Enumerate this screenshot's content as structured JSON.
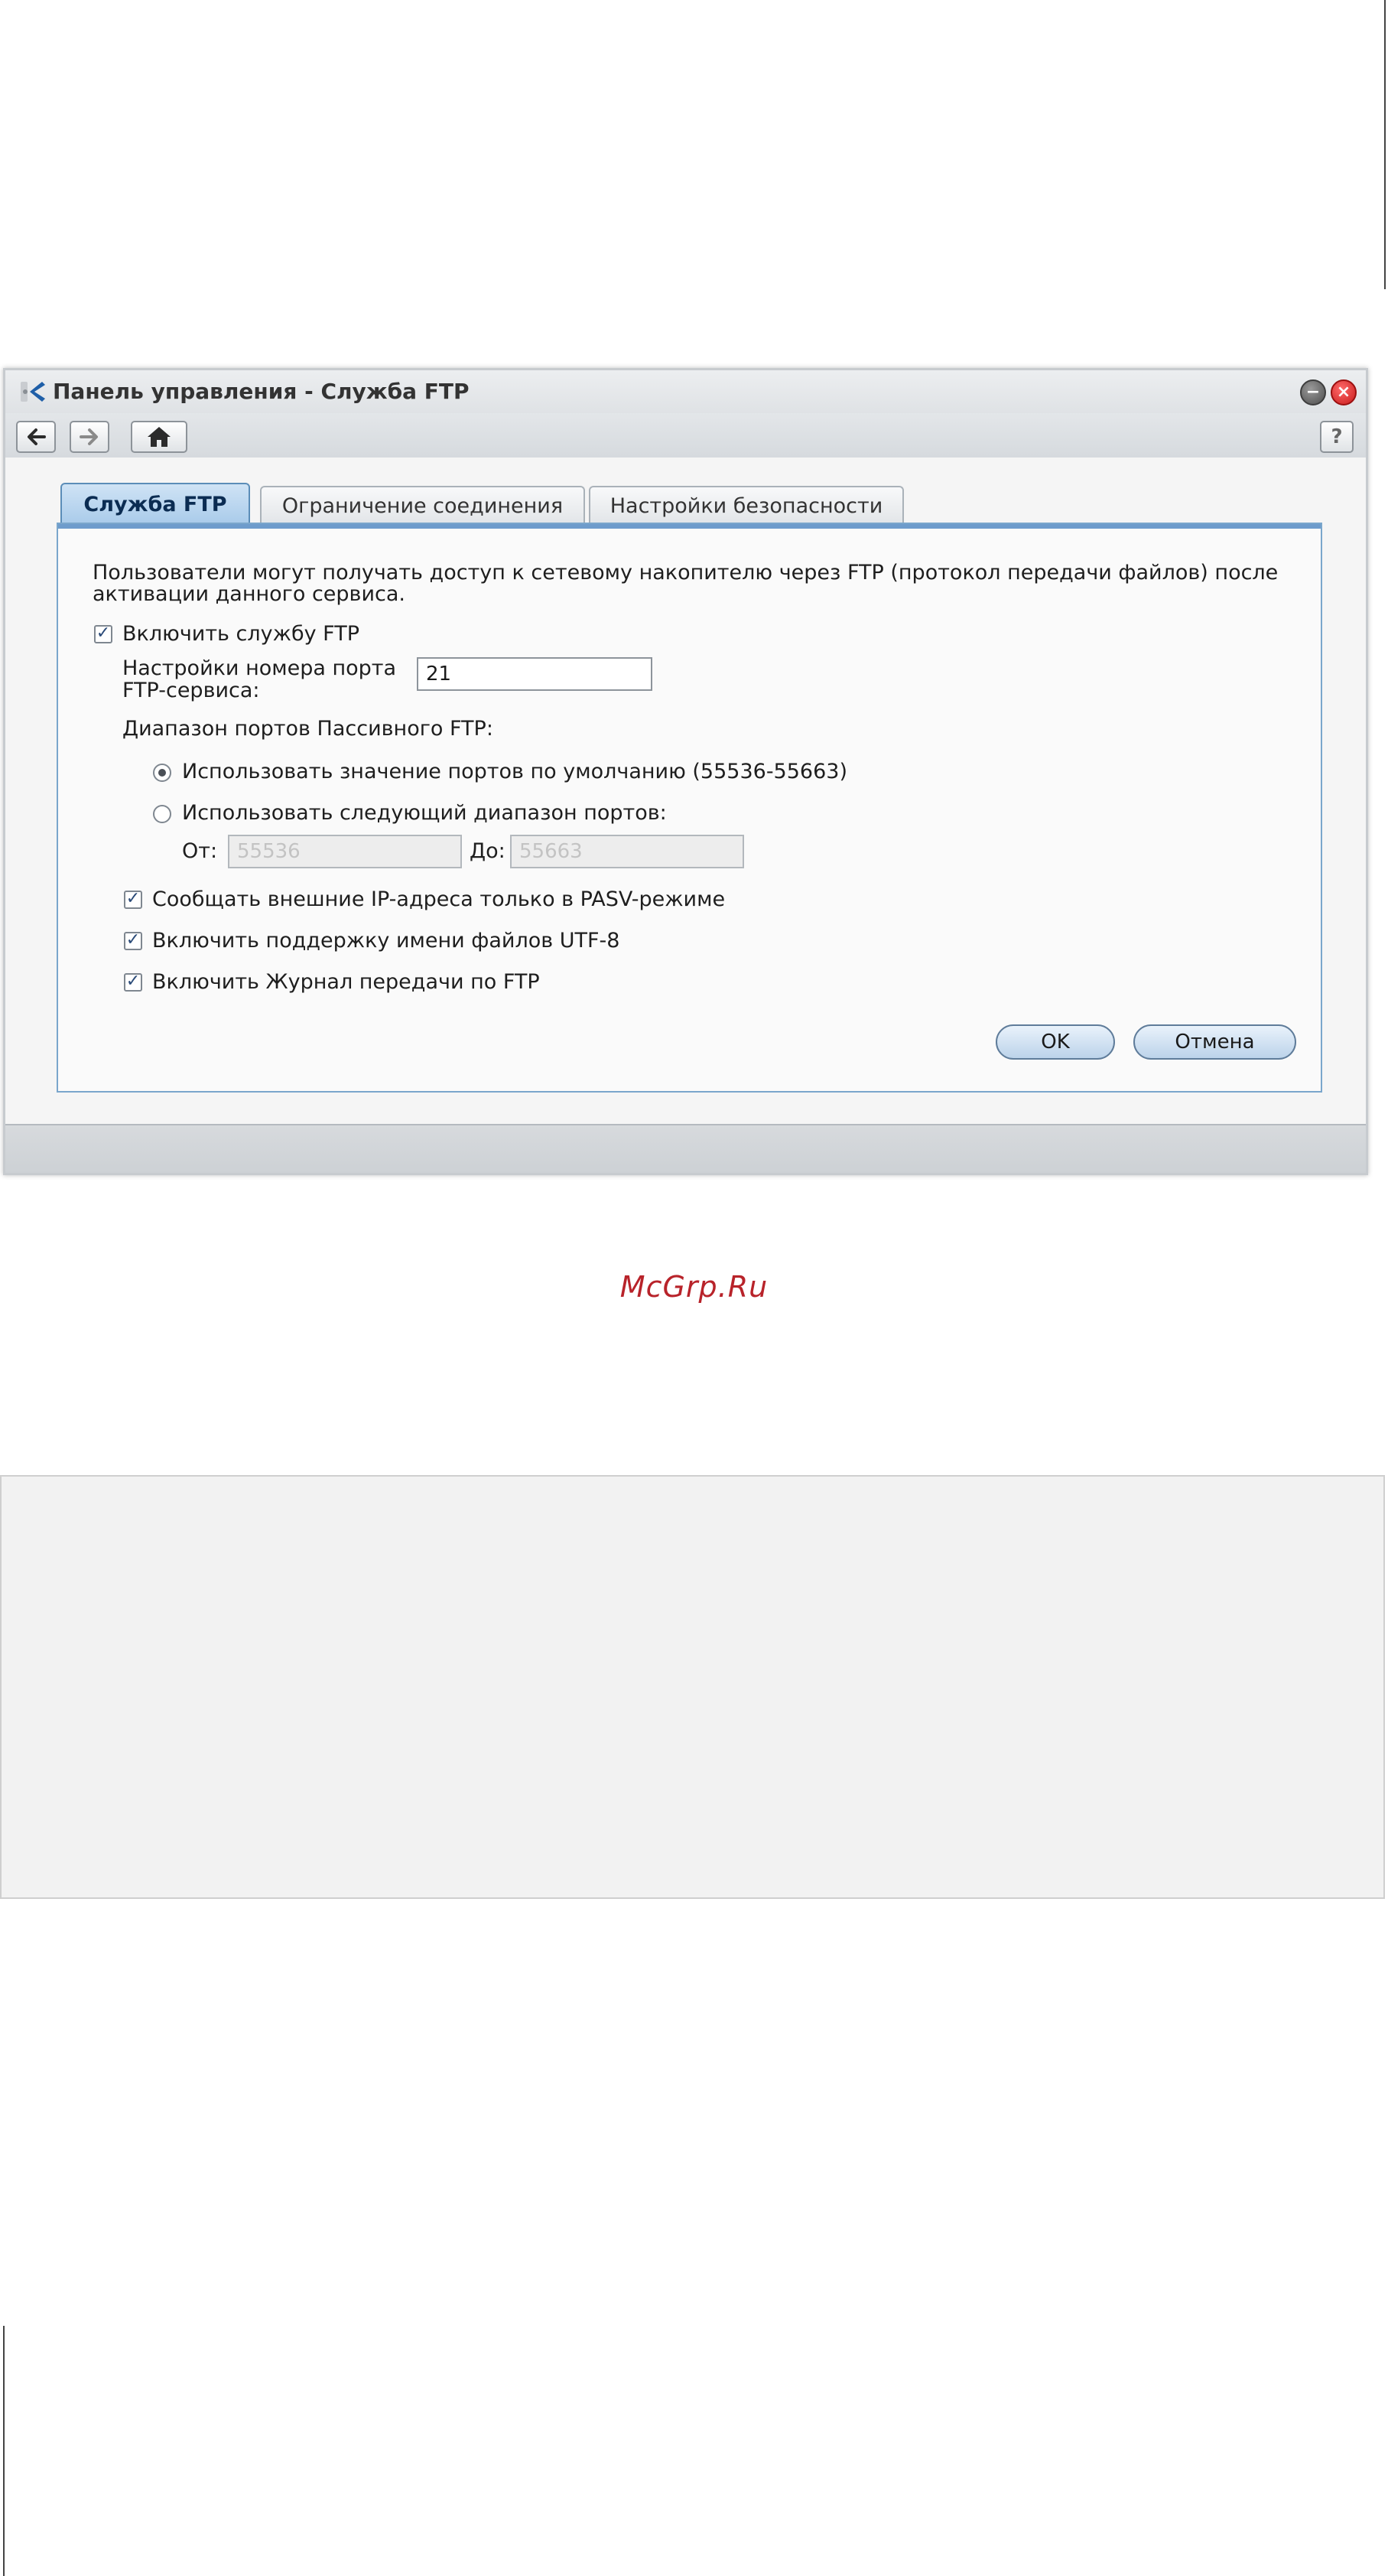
{
  "window": {
    "title": "Панель управления - Служба FTP"
  },
  "toolbar": {
    "help_label": "?"
  },
  "tabs": [
    {
      "label": "Служба FTP",
      "active": true
    },
    {
      "label": "Ограничение соединения",
      "active": false
    },
    {
      "label": "Настройки безопасности",
      "active": false
    }
  ],
  "form": {
    "description_line1": "Пользователи могут получать доступ к сетевому накопителю через FTP (протокол передачи файлов) после",
    "description_line2": "активации данного сервиса.",
    "enable_ftp": {
      "label": "Включить службу FTP",
      "checked": true
    },
    "port_label_line1": "Настройки номера порта",
    "port_label_line2": "FTP-сервиса:",
    "port_value": "21",
    "passive_range_label": "Диапазон портов Пассивного FTP:",
    "radio_default": {
      "label": "Использовать значение портов по умолчанию (55536-55663)",
      "selected": true
    },
    "radio_custom": {
      "label": "Использовать следующий диапазон портов:",
      "selected": false
    },
    "from_label": "От:",
    "from_value": "55536",
    "to_label": "До:",
    "to_value": "55663",
    "check_pasv": {
      "label": "Сообщать внешние IP-адреса только в PASV-режиме",
      "checked": true
    },
    "check_utf8": {
      "label": "Включить поддержку имени файлов UTF-8",
      "checked": true
    },
    "check_log": {
      "label": "Включить Журнал передачи по FTP",
      "checked": true
    },
    "ok_label": "OK",
    "cancel_label": "Отмена"
  },
  "watermark": "McGrp.Ru",
  "colors": {
    "accent_tab": "#a9cbea",
    "panel_border": "#7aa6cc",
    "close_red": "#c81b1b",
    "watermark_red": "#b8232a"
  }
}
